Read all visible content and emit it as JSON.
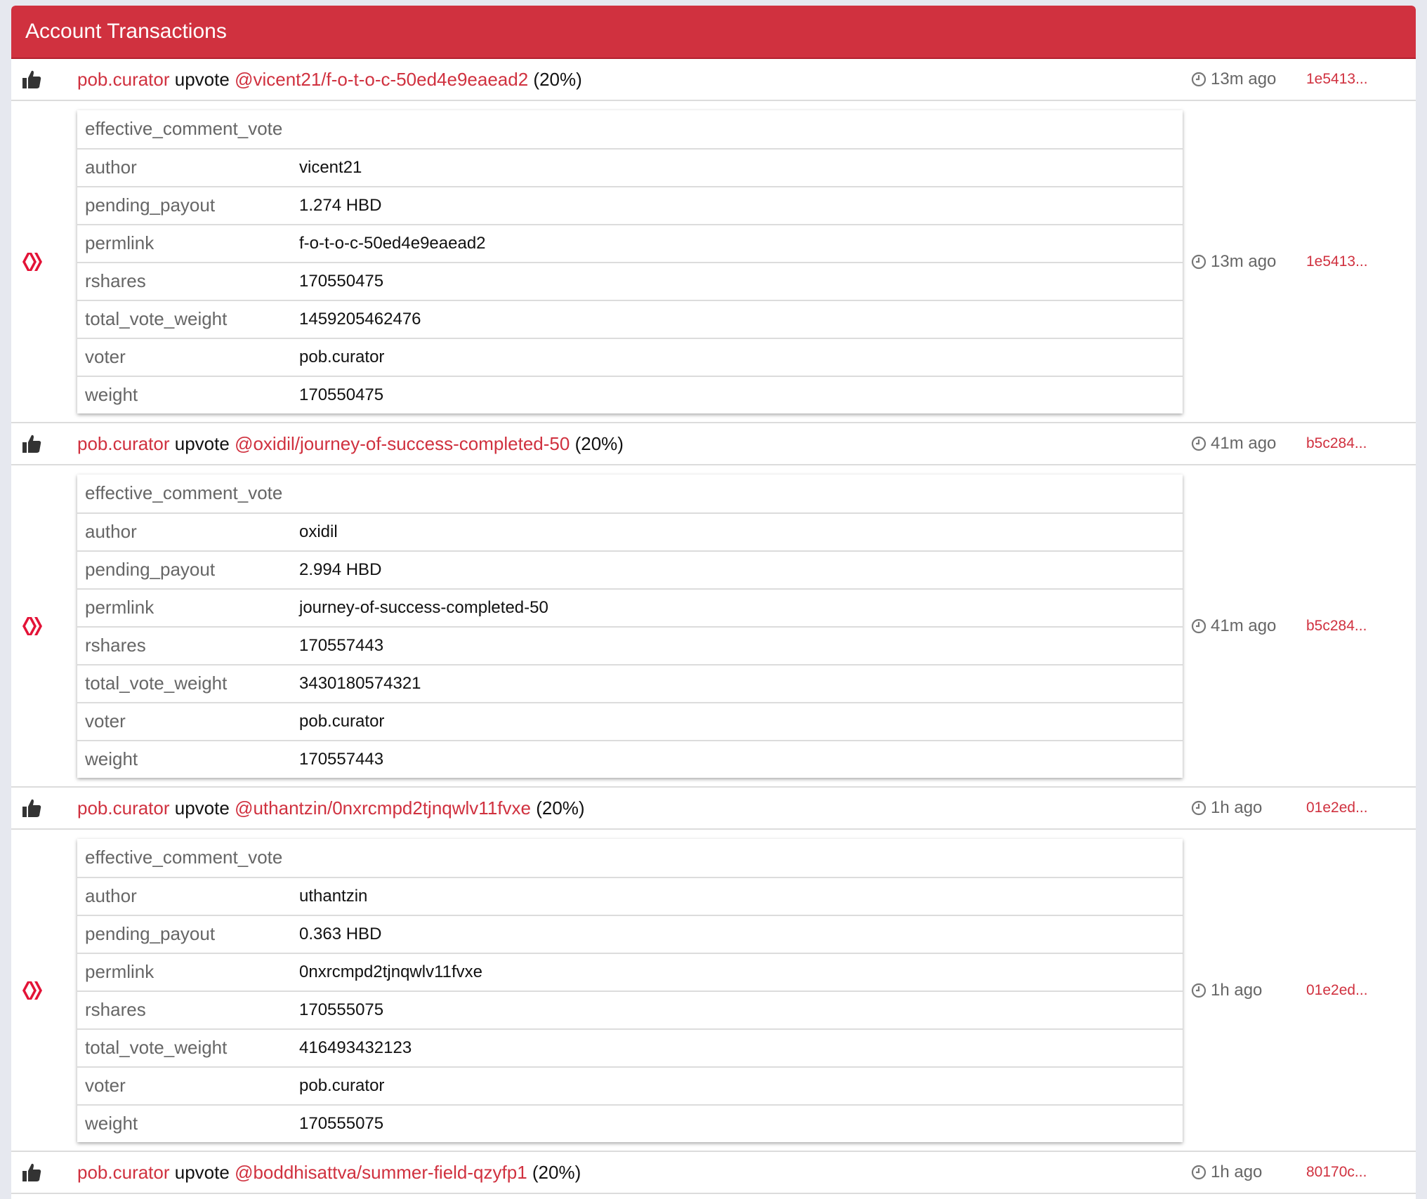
{
  "header": {
    "title": "Account Transactions"
  },
  "colors": {
    "accent": "#d0313f"
  },
  "card_title": "effective_comment_vote",
  "transactions": [
    {
      "voter": "pob.curator",
      "action": "upvote",
      "target": "@vicent21/f-o-t-o-c-50ed4e9eaead2",
      "percent": "(20%)",
      "time": "13m ago",
      "hash": "1e5413...",
      "details": [
        {
          "key": "author",
          "value": "vicent21"
        },
        {
          "key": "pending_payout",
          "value": "1.274 HBD"
        },
        {
          "key": "permlink",
          "value": "f-o-t-o-c-50ed4e9eaead2"
        },
        {
          "key": "rshares",
          "value": "170550475"
        },
        {
          "key": "total_vote_weight",
          "value": "1459205462476"
        },
        {
          "key": "voter",
          "value": "pob.curator"
        },
        {
          "key": "weight",
          "value": "170550475"
        }
      ]
    },
    {
      "voter": "pob.curator",
      "action": "upvote",
      "target": "@oxidil/journey-of-success-completed-50",
      "percent": "(20%)",
      "time": "41m ago",
      "hash": "b5c284...",
      "details": [
        {
          "key": "author",
          "value": "oxidil"
        },
        {
          "key": "pending_payout",
          "value": "2.994 HBD"
        },
        {
          "key": "permlink",
          "value": "journey-of-success-completed-50"
        },
        {
          "key": "rshares",
          "value": "170557443"
        },
        {
          "key": "total_vote_weight",
          "value": "3430180574321"
        },
        {
          "key": "voter",
          "value": "pob.curator"
        },
        {
          "key": "weight",
          "value": "170557443"
        }
      ]
    },
    {
      "voter": "pob.curator",
      "action": "upvote",
      "target": "@uthantzin/0nxrcmpd2tjnqwlv11fvxe",
      "percent": "(20%)",
      "time": "1h ago",
      "hash": "01e2ed...",
      "details": [
        {
          "key": "author",
          "value": "uthantzin"
        },
        {
          "key": "pending_payout",
          "value": "0.363 HBD"
        },
        {
          "key": "permlink",
          "value": "0nxrcmpd2tjnqwlv11fvxe"
        },
        {
          "key": "rshares",
          "value": "170555075"
        },
        {
          "key": "total_vote_weight",
          "value": "416493432123"
        },
        {
          "key": "voter",
          "value": "pob.curator"
        },
        {
          "key": "weight",
          "value": "170555075"
        }
      ]
    },
    {
      "voter": "pob.curator",
      "action": "upvote",
      "target": "@boddhisattva/summer-field-qzyfp1",
      "percent": "(20%)",
      "time": "1h ago",
      "hash": "80170c...",
      "details": []
    }
  ]
}
